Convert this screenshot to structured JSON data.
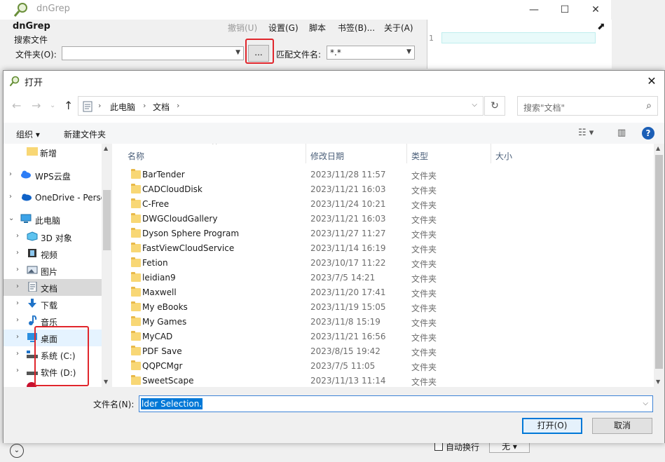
{
  "app": {
    "title": "dnGrep",
    "name": "dnGrep",
    "menu": [
      "撤销(U)",
      "设置(G)",
      "脚本",
      "书签(B)...",
      "关于(A)"
    ],
    "search_group": "搜索文件",
    "folder_label": "文件夹(O):",
    "folder_value": "",
    "browse_label": "...",
    "pattern_label": "匹配文件名:",
    "pattern_value": "*.*",
    "editor_line_number": "1",
    "wrap_label": "自动换行",
    "none_label": "无 ▾"
  },
  "dialog": {
    "title": "打开",
    "breadcrumb": [
      "此电脑",
      "文档"
    ],
    "search_placeholder": "搜索\"文档\"",
    "organize": "组织 ▾",
    "new_folder": "新建文件夹",
    "nav_items": [
      {
        "label": "新增",
        "icon": "folder-icon",
        "level": 1
      },
      {
        "label": "WPS云盘",
        "icon": "cloud-icon",
        "level": 0
      },
      {
        "label": "OneDrive - Perso",
        "icon": "onedrive-icon",
        "level": 0
      },
      {
        "label": "此电脑",
        "icon": "computer-icon",
        "level": 0
      },
      {
        "label": "3D 对象",
        "icon": "3d-objects-icon",
        "level": 1
      },
      {
        "label": "视频",
        "icon": "video-icon",
        "level": 1
      },
      {
        "label": "图片",
        "icon": "picture-icon",
        "level": 1
      },
      {
        "label": "文档",
        "icon": "document-icon",
        "level": 1
      },
      {
        "label": "下载",
        "icon": "download-icon",
        "level": 1
      },
      {
        "label": "音乐",
        "icon": "music-icon",
        "level": 1
      },
      {
        "label": "桌面",
        "icon": "desktop-icon",
        "level": 1
      },
      {
        "label": "系统 (C:)",
        "icon": "drive-c-icon",
        "level": 1
      },
      {
        "label": "软件 (D:)",
        "icon": "drive-d-icon",
        "level": 1
      }
    ],
    "columns": [
      "名称",
      "修改日期",
      "类型",
      "大小"
    ],
    "files": [
      {
        "name": "BarTender",
        "date": "2023/11/28 11:57",
        "type": "文件夹"
      },
      {
        "name": "CADCloudDisk",
        "date": "2023/11/21 16:03",
        "type": "文件夹"
      },
      {
        "name": "C-Free",
        "date": "2023/11/24 10:21",
        "type": "文件夹"
      },
      {
        "name": "DWGCloudGallery",
        "date": "2023/11/21 16:03",
        "type": "文件夹"
      },
      {
        "name": "Dyson Sphere Program",
        "date": "2023/11/27 11:27",
        "type": "文件夹"
      },
      {
        "name": "FastViewCloudService",
        "date": "2023/11/14 16:19",
        "type": "文件夹"
      },
      {
        "name": "Fetion",
        "date": "2023/10/17 11:22",
        "type": "文件夹"
      },
      {
        "name": "leidian9",
        "date": "2023/7/5 14:21",
        "type": "文件夹"
      },
      {
        "name": "Maxwell",
        "date": "2023/11/20 17:41",
        "type": "文件夹"
      },
      {
        "name": "My eBooks",
        "date": "2023/11/19 15:05",
        "type": "文件夹"
      },
      {
        "name": "My Games",
        "date": "2023/11/8 15:19",
        "type": "文件夹"
      },
      {
        "name": "MyCAD",
        "date": "2023/11/21 16:56",
        "type": "文件夹"
      },
      {
        "name": "PDF Save",
        "date": "2023/8/15 19:42",
        "type": "文件夹"
      },
      {
        "name": "QQPCMgr",
        "date": "2023/7/5 11:05",
        "type": "文件夹"
      },
      {
        "name": "SweetScape",
        "date": "2023/11/13 11:14",
        "type": "文件夹"
      }
    ],
    "filename_label": "文件名(N):",
    "filename_value": "lder Selection.",
    "open_button": "打开(O)",
    "cancel_button": "取消"
  }
}
